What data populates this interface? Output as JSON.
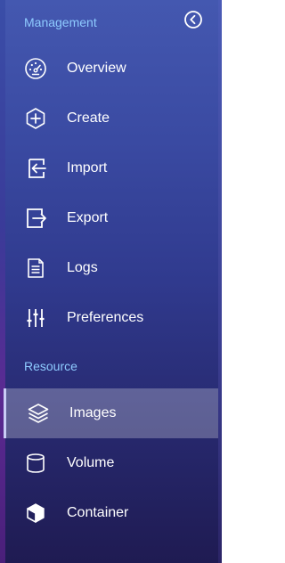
{
  "sidebar": {
    "sections": [
      {
        "label": "Management",
        "items": [
          {
            "label": "Overview",
            "icon": "dashboard-gauge-icon"
          },
          {
            "label": "Create",
            "icon": "hexagon-plus-icon"
          },
          {
            "label": "Import",
            "icon": "import-icon"
          },
          {
            "label": "Export",
            "icon": "export-icon"
          },
          {
            "label": "Logs",
            "icon": "document-icon"
          },
          {
            "label": "Preferences",
            "icon": "sliders-icon"
          }
        ]
      },
      {
        "label": "Resource",
        "items": [
          {
            "label": "Images",
            "icon": "layers-icon",
            "active": true
          },
          {
            "label": "Volume",
            "icon": "cylinder-icon"
          },
          {
            "label": "Container",
            "icon": "cube-icon"
          }
        ]
      }
    ],
    "collapse_icon": "chevron-left-circle-icon",
    "colors": {
      "section_label": "#8ecbff",
      "item_text": "#ffffff",
      "active_bg": "rgba(255,255,255,0.26)"
    }
  }
}
